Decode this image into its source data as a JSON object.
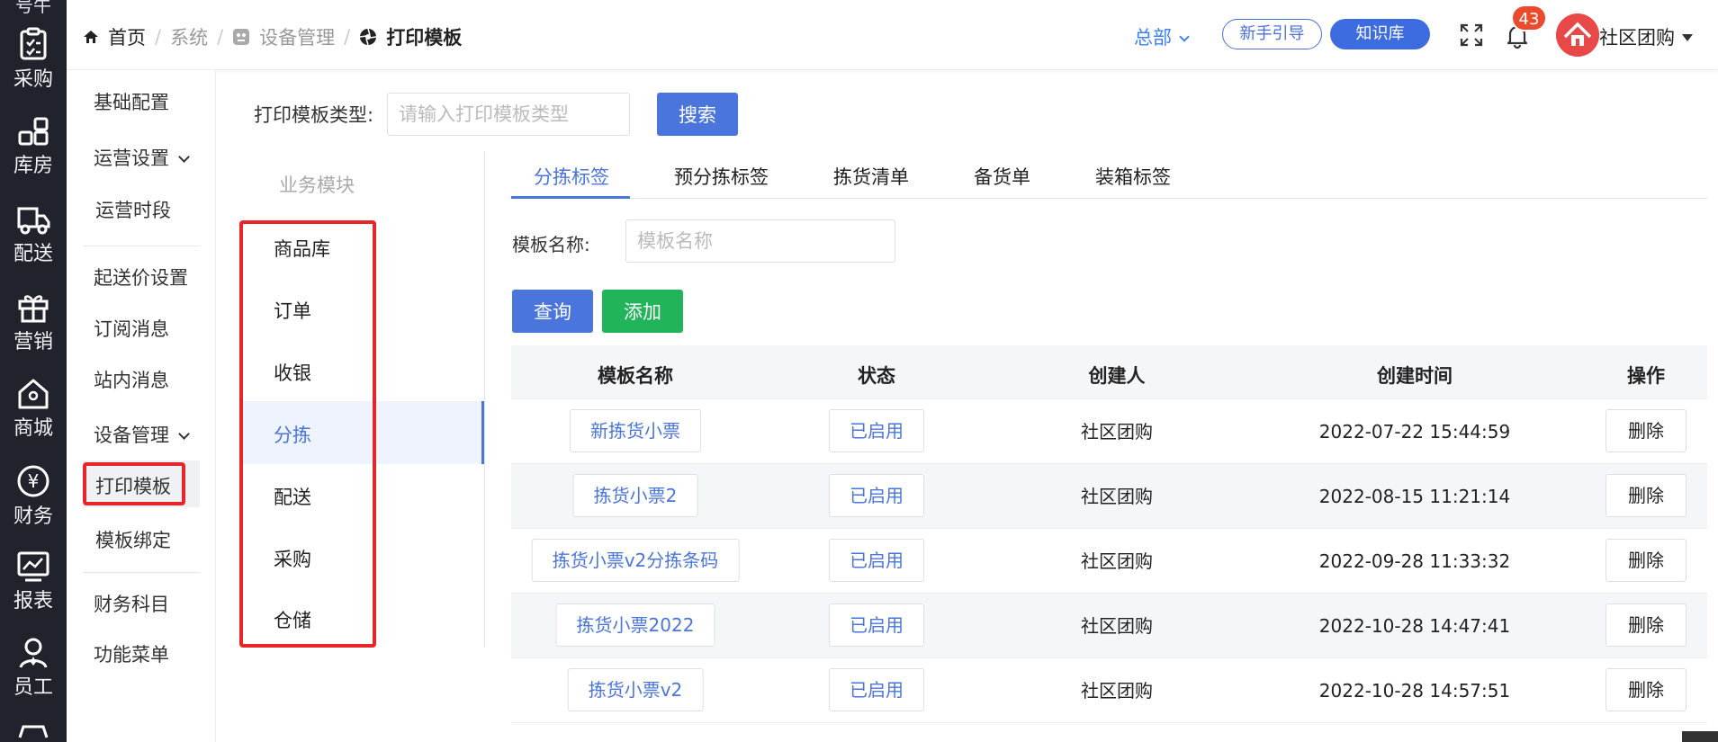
{
  "rail": {
    "top_label": "号牛",
    "items": [
      {
        "label": "采购",
        "icon": "purchase-icon"
      },
      {
        "label": "库房",
        "icon": "warehouse-icon"
      },
      {
        "label": "配送",
        "icon": "delivery-truck-icon"
      },
      {
        "label": "营销",
        "icon": "gift-icon"
      },
      {
        "label": "商城",
        "icon": "shop-home-icon"
      },
      {
        "label": "财务",
        "icon": "yen-icon"
      },
      {
        "label": "报表",
        "icon": "chart-icon"
      },
      {
        "label": "员工",
        "icon": "staff-icon"
      }
    ]
  },
  "submenu": {
    "basic": "基础配置",
    "ops": "运营设置",
    "ops_period": "运营时段",
    "min_price": "起送价设置",
    "subscribe": "订阅消息",
    "site_msg": "站内消息",
    "device_mgmt": "设备管理",
    "print_tpl": "打印模板",
    "tpl_bind": "模板绑定",
    "finance_subject": "财务科目",
    "func_menu": "功能菜单"
  },
  "header": {
    "crumbs": [
      "首页",
      "系统",
      "设备管理",
      "打印模板"
    ],
    "hq": "总部",
    "guide": "新手引导",
    "kb": "知识库",
    "badge": "43",
    "user": "社区团购"
  },
  "filter": {
    "label": "打印模板类型:",
    "placeholder": "请输入打印模板类型",
    "search": "搜索"
  },
  "biz": {
    "title": "业务模块",
    "items": [
      "商品库",
      "订单",
      "收银",
      "分拣",
      "配送",
      "采购",
      "仓储"
    ],
    "active": "分拣"
  },
  "tabs": [
    "分拣标签",
    "预分拣标签",
    "拣货清单",
    "备货单",
    "装箱标签"
  ],
  "form": {
    "name_label": "模板名称:",
    "name_placeholder": "模板名称",
    "query": "查询",
    "add": "添加"
  },
  "table": {
    "headers": [
      "模板名称",
      "状态",
      "创建人",
      "创建时间",
      "操作"
    ],
    "rows": [
      {
        "name": "新拣货小票",
        "status": "已启用",
        "creator": "社区团购",
        "time": "2022-07-22 15:44:59",
        "action": "删除"
      },
      {
        "name": "拣货小票2",
        "status": "已启用",
        "creator": "社区团购",
        "time": "2022-08-15 11:21:14",
        "action": "删除"
      },
      {
        "name": "拣货小票v2分拣条码",
        "status": "已启用",
        "creator": "社区团购",
        "time": "2022-09-28 11:33:32",
        "action": "删除"
      },
      {
        "name": "拣货小票2022",
        "status": "已启用",
        "creator": "社区团购",
        "time": "2022-10-28 14:47:41",
        "action": "删除"
      },
      {
        "name": "拣货小票v2",
        "status": "已启用",
        "creator": "社区团购",
        "time": "2022-10-28 14:57:51",
        "action": "删除"
      }
    ]
  },
  "colors": {
    "accent": "#4a75dc",
    "add": "#22b45a",
    "rail": "#20232b",
    "highlight": "#e8262a",
    "badge": "#ec4a2c"
  }
}
